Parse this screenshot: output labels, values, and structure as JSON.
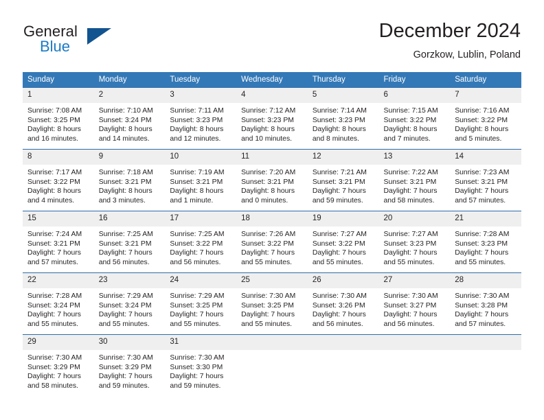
{
  "brand": {
    "name_part1": "General",
    "name_part2": "Blue",
    "accent_color": "#1a7bc4",
    "mark_color": "#12548f",
    "logo_icon": "triangle-flag-icon"
  },
  "header": {
    "title": "December 2024",
    "subtitle": "Gorzkow, Lublin, Poland"
  },
  "calendar": {
    "header_background": "#3479b7",
    "header_text_color": "#ffffff",
    "daynum_background": "#efefef",
    "row_border_color": "#2d6ca8",
    "weekdays": [
      "Sunday",
      "Monday",
      "Tuesday",
      "Wednesday",
      "Thursday",
      "Friday",
      "Saturday"
    ],
    "weeks": [
      [
        {
          "day": "1",
          "sunrise": "Sunrise: 7:08 AM",
          "sunset": "Sunset: 3:25 PM",
          "daylight_line1": "Daylight: 8 hours",
          "daylight_line2": "and 16 minutes."
        },
        {
          "day": "2",
          "sunrise": "Sunrise: 7:10 AM",
          "sunset": "Sunset: 3:24 PM",
          "daylight_line1": "Daylight: 8 hours",
          "daylight_line2": "and 14 minutes."
        },
        {
          "day": "3",
          "sunrise": "Sunrise: 7:11 AM",
          "sunset": "Sunset: 3:23 PM",
          "daylight_line1": "Daylight: 8 hours",
          "daylight_line2": "and 12 minutes."
        },
        {
          "day": "4",
          "sunrise": "Sunrise: 7:12 AM",
          "sunset": "Sunset: 3:23 PM",
          "daylight_line1": "Daylight: 8 hours",
          "daylight_line2": "and 10 minutes."
        },
        {
          "day": "5",
          "sunrise": "Sunrise: 7:14 AM",
          "sunset": "Sunset: 3:23 PM",
          "daylight_line1": "Daylight: 8 hours",
          "daylight_line2": "and 8 minutes."
        },
        {
          "day": "6",
          "sunrise": "Sunrise: 7:15 AM",
          "sunset": "Sunset: 3:22 PM",
          "daylight_line1": "Daylight: 8 hours",
          "daylight_line2": "and 7 minutes."
        },
        {
          "day": "7",
          "sunrise": "Sunrise: 7:16 AM",
          "sunset": "Sunset: 3:22 PM",
          "daylight_line1": "Daylight: 8 hours",
          "daylight_line2": "and 5 minutes."
        }
      ],
      [
        {
          "day": "8",
          "sunrise": "Sunrise: 7:17 AM",
          "sunset": "Sunset: 3:22 PM",
          "daylight_line1": "Daylight: 8 hours",
          "daylight_line2": "and 4 minutes."
        },
        {
          "day": "9",
          "sunrise": "Sunrise: 7:18 AM",
          "sunset": "Sunset: 3:21 PM",
          "daylight_line1": "Daylight: 8 hours",
          "daylight_line2": "and 3 minutes."
        },
        {
          "day": "10",
          "sunrise": "Sunrise: 7:19 AM",
          "sunset": "Sunset: 3:21 PM",
          "daylight_line1": "Daylight: 8 hours",
          "daylight_line2": "and 1 minute."
        },
        {
          "day": "11",
          "sunrise": "Sunrise: 7:20 AM",
          "sunset": "Sunset: 3:21 PM",
          "daylight_line1": "Daylight: 8 hours",
          "daylight_line2": "and 0 minutes."
        },
        {
          "day": "12",
          "sunrise": "Sunrise: 7:21 AM",
          "sunset": "Sunset: 3:21 PM",
          "daylight_line1": "Daylight: 7 hours",
          "daylight_line2": "and 59 minutes."
        },
        {
          "day": "13",
          "sunrise": "Sunrise: 7:22 AM",
          "sunset": "Sunset: 3:21 PM",
          "daylight_line1": "Daylight: 7 hours",
          "daylight_line2": "and 58 minutes."
        },
        {
          "day": "14",
          "sunrise": "Sunrise: 7:23 AM",
          "sunset": "Sunset: 3:21 PM",
          "daylight_line1": "Daylight: 7 hours",
          "daylight_line2": "and 57 minutes."
        }
      ],
      [
        {
          "day": "15",
          "sunrise": "Sunrise: 7:24 AM",
          "sunset": "Sunset: 3:21 PM",
          "daylight_line1": "Daylight: 7 hours",
          "daylight_line2": "and 57 minutes."
        },
        {
          "day": "16",
          "sunrise": "Sunrise: 7:25 AM",
          "sunset": "Sunset: 3:21 PM",
          "daylight_line1": "Daylight: 7 hours",
          "daylight_line2": "and 56 minutes."
        },
        {
          "day": "17",
          "sunrise": "Sunrise: 7:25 AM",
          "sunset": "Sunset: 3:22 PM",
          "daylight_line1": "Daylight: 7 hours",
          "daylight_line2": "and 56 minutes."
        },
        {
          "day": "18",
          "sunrise": "Sunrise: 7:26 AM",
          "sunset": "Sunset: 3:22 PM",
          "daylight_line1": "Daylight: 7 hours",
          "daylight_line2": "and 55 minutes."
        },
        {
          "day": "19",
          "sunrise": "Sunrise: 7:27 AM",
          "sunset": "Sunset: 3:22 PM",
          "daylight_line1": "Daylight: 7 hours",
          "daylight_line2": "and 55 minutes."
        },
        {
          "day": "20",
          "sunrise": "Sunrise: 7:27 AM",
          "sunset": "Sunset: 3:23 PM",
          "daylight_line1": "Daylight: 7 hours",
          "daylight_line2": "and 55 minutes."
        },
        {
          "day": "21",
          "sunrise": "Sunrise: 7:28 AM",
          "sunset": "Sunset: 3:23 PM",
          "daylight_line1": "Daylight: 7 hours",
          "daylight_line2": "and 55 minutes."
        }
      ],
      [
        {
          "day": "22",
          "sunrise": "Sunrise: 7:28 AM",
          "sunset": "Sunset: 3:24 PM",
          "daylight_line1": "Daylight: 7 hours",
          "daylight_line2": "and 55 minutes."
        },
        {
          "day": "23",
          "sunrise": "Sunrise: 7:29 AM",
          "sunset": "Sunset: 3:24 PM",
          "daylight_line1": "Daylight: 7 hours",
          "daylight_line2": "and 55 minutes."
        },
        {
          "day": "24",
          "sunrise": "Sunrise: 7:29 AM",
          "sunset": "Sunset: 3:25 PM",
          "daylight_line1": "Daylight: 7 hours",
          "daylight_line2": "and 55 minutes."
        },
        {
          "day": "25",
          "sunrise": "Sunrise: 7:30 AM",
          "sunset": "Sunset: 3:25 PM",
          "daylight_line1": "Daylight: 7 hours",
          "daylight_line2": "and 55 minutes."
        },
        {
          "day": "26",
          "sunrise": "Sunrise: 7:30 AM",
          "sunset": "Sunset: 3:26 PM",
          "daylight_line1": "Daylight: 7 hours",
          "daylight_line2": "and 56 minutes."
        },
        {
          "day": "27",
          "sunrise": "Sunrise: 7:30 AM",
          "sunset": "Sunset: 3:27 PM",
          "daylight_line1": "Daylight: 7 hours",
          "daylight_line2": "and 56 minutes."
        },
        {
          "day": "28",
          "sunrise": "Sunrise: 7:30 AM",
          "sunset": "Sunset: 3:28 PM",
          "daylight_line1": "Daylight: 7 hours",
          "daylight_line2": "and 57 minutes."
        }
      ],
      [
        {
          "day": "29",
          "sunrise": "Sunrise: 7:30 AM",
          "sunset": "Sunset: 3:29 PM",
          "daylight_line1": "Daylight: 7 hours",
          "daylight_line2": "and 58 minutes."
        },
        {
          "day": "30",
          "sunrise": "Sunrise: 7:30 AM",
          "sunset": "Sunset: 3:29 PM",
          "daylight_line1": "Daylight: 7 hours",
          "daylight_line2": "and 59 minutes."
        },
        {
          "day": "31",
          "sunrise": "Sunrise: 7:30 AM",
          "sunset": "Sunset: 3:30 PM",
          "daylight_line1": "Daylight: 7 hours",
          "daylight_line2": "and 59 minutes."
        },
        {
          "day": "",
          "sunrise": "",
          "sunset": "",
          "daylight_line1": "",
          "daylight_line2": ""
        },
        {
          "day": "",
          "sunrise": "",
          "sunset": "",
          "daylight_line1": "",
          "daylight_line2": ""
        },
        {
          "day": "",
          "sunrise": "",
          "sunset": "",
          "daylight_line1": "",
          "daylight_line2": ""
        },
        {
          "day": "",
          "sunrise": "",
          "sunset": "",
          "daylight_line1": "",
          "daylight_line2": ""
        }
      ]
    ]
  }
}
